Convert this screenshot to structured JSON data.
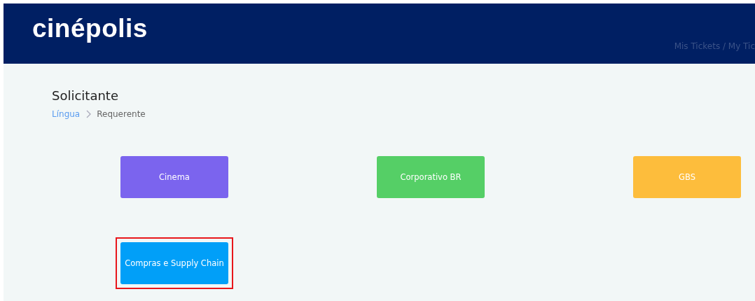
{
  "header": {
    "logo": "cinépolis",
    "nav_link": "Mis Tickets / My Tic"
  },
  "page": {
    "title": "Solicitante",
    "breadcrumb": [
      {
        "label": "Língua",
        "link": true
      },
      {
        "label": "Requerente",
        "link": false
      }
    ]
  },
  "tiles": [
    {
      "label": "Cinema",
      "color": "#7b64ee",
      "highlighted": false
    },
    {
      "label": "Corporativo BR",
      "color": "#55cf66",
      "highlighted": false
    },
    {
      "label": "GBS",
      "color": "#fdbd3c",
      "highlighted": false
    },
    {
      "label": "Compras e Supply Chain",
      "color": "#019ff8",
      "highlighted": true
    }
  ]
}
